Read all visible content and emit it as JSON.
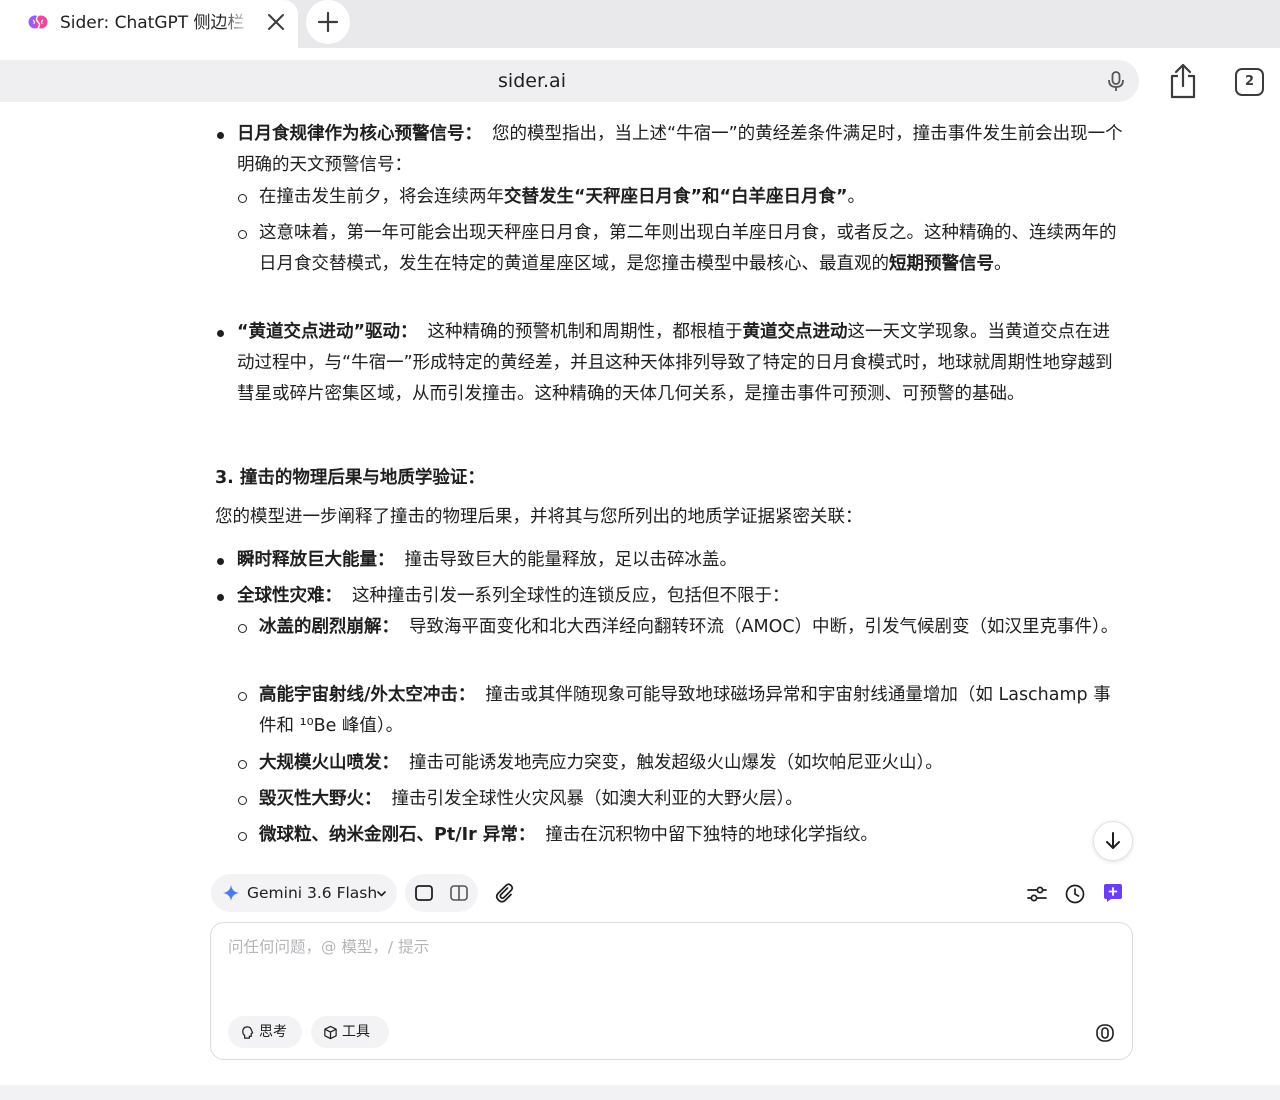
{
  "browser": {
    "tab": {
      "title": "Sider: ChatGPT 侧边栏 +"
    },
    "url": "sider.ai",
    "tab_count": "2"
  },
  "message": {
    "b1": {
      "strong": "日月食规律作为核心预警信号：",
      "text": "您的模型指出，当上述“牛宿一”的黄经差条件满足时，撞击事件发生前会出现一个明确的天文预警信号："
    },
    "b1_s1": {
      "text1": "在撞击发生前夕，将会连续两年",
      "strong": "交替发生“天秤座日月食”和“白羊座日月食”",
      "text2": "。"
    },
    "b1_s2": {
      "text": "这意味着，第一年可能会出现天秤座日月食，第二年则出现白羊座日月食，或者反之。这种精确的、连续两年的日月食交替模式，发生在特定的黄道星座区域，是您撞击模型中最核心、最直观的",
      "strong": "短期预警信号",
      "text2": "。"
    },
    "b2": {
      "strong": "“黄道交点进动”驱动：",
      "text1": "这种精确的预警机制和周期性，都根植于",
      "strong2": "黄道交点进动",
      "text2": "这一天文学现象。当黄道交点在进动过程中，与“牛宿一”形成特定的黄经差，并且这种天体排列导致了特定的日月食模式时，地球就周期性地穿越到彗星或碎片密集区域，从而引发撞击。这种精确的天体几何关系，是撞击事件可预测、可预警的基础。"
    },
    "section3_heading": "3. 撞击的物理后果与地质学验证：",
    "section3_intro": "您的模型进一步阐释了撞击的物理后果，并将其与您所列出的地质学证据紧密关联：",
    "c1": {
      "strong": "瞬时释放巨大能量：",
      "text": "撞击导致巨大的能量释放，足以击碎冰盖。"
    },
    "c2": {
      "strong": "全球性灾难：",
      "text": "这种撞击引发一系列全球性的连锁反应，包括但不限于："
    },
    "c2_s1": {
      "strong": "冰盖的剧烈崩解：",
      "text": "导致海平面变化和北大西洋经向翻转环流（AMOC）中断，引发气候剧变（如汉里克事件）。"
    },
    "c2_s2": {
      "strong": "高能宇宙射线/外太空冲击：",
      "text": "撞击或其伴随现象可能导致地球磁场异常和宇宙射线通量增加（如 Laschamp 事件和 ¹⁰Be 峰值）。"
    },
    "c2_s3": {
      "strong": "大规模火山喷发：",
      "text": "撞击可能诱发地壳应力突变，触发超级火山爆发（如坎帕尼亚火山）。"
    },
    "c2_s4": {
      "strong": "毁灭性大野火：",
      "text": "撞击引发全球性火灾风暴（如澳大利亚的大野火层）。"
    },
    "c2_s5": {
      "strong": "微球粒、纳米金刚石、Pt/Ir 异常：",
      "text": "撞击在沉积物中留下独特的地球化学指纹。"
    }
  },
  "composer": {
    "model_name": "Gemini 3.6 Flash",
    "placeholder": "问任何问题，@ 模型，/ 提示",
    "think_label": "思考",
    "tools_label": "工具"
  },
  "colors": {
    "accent_purple": "#6b3df5",
    "model_star_blue": "#4a7bf0"
  }
}
